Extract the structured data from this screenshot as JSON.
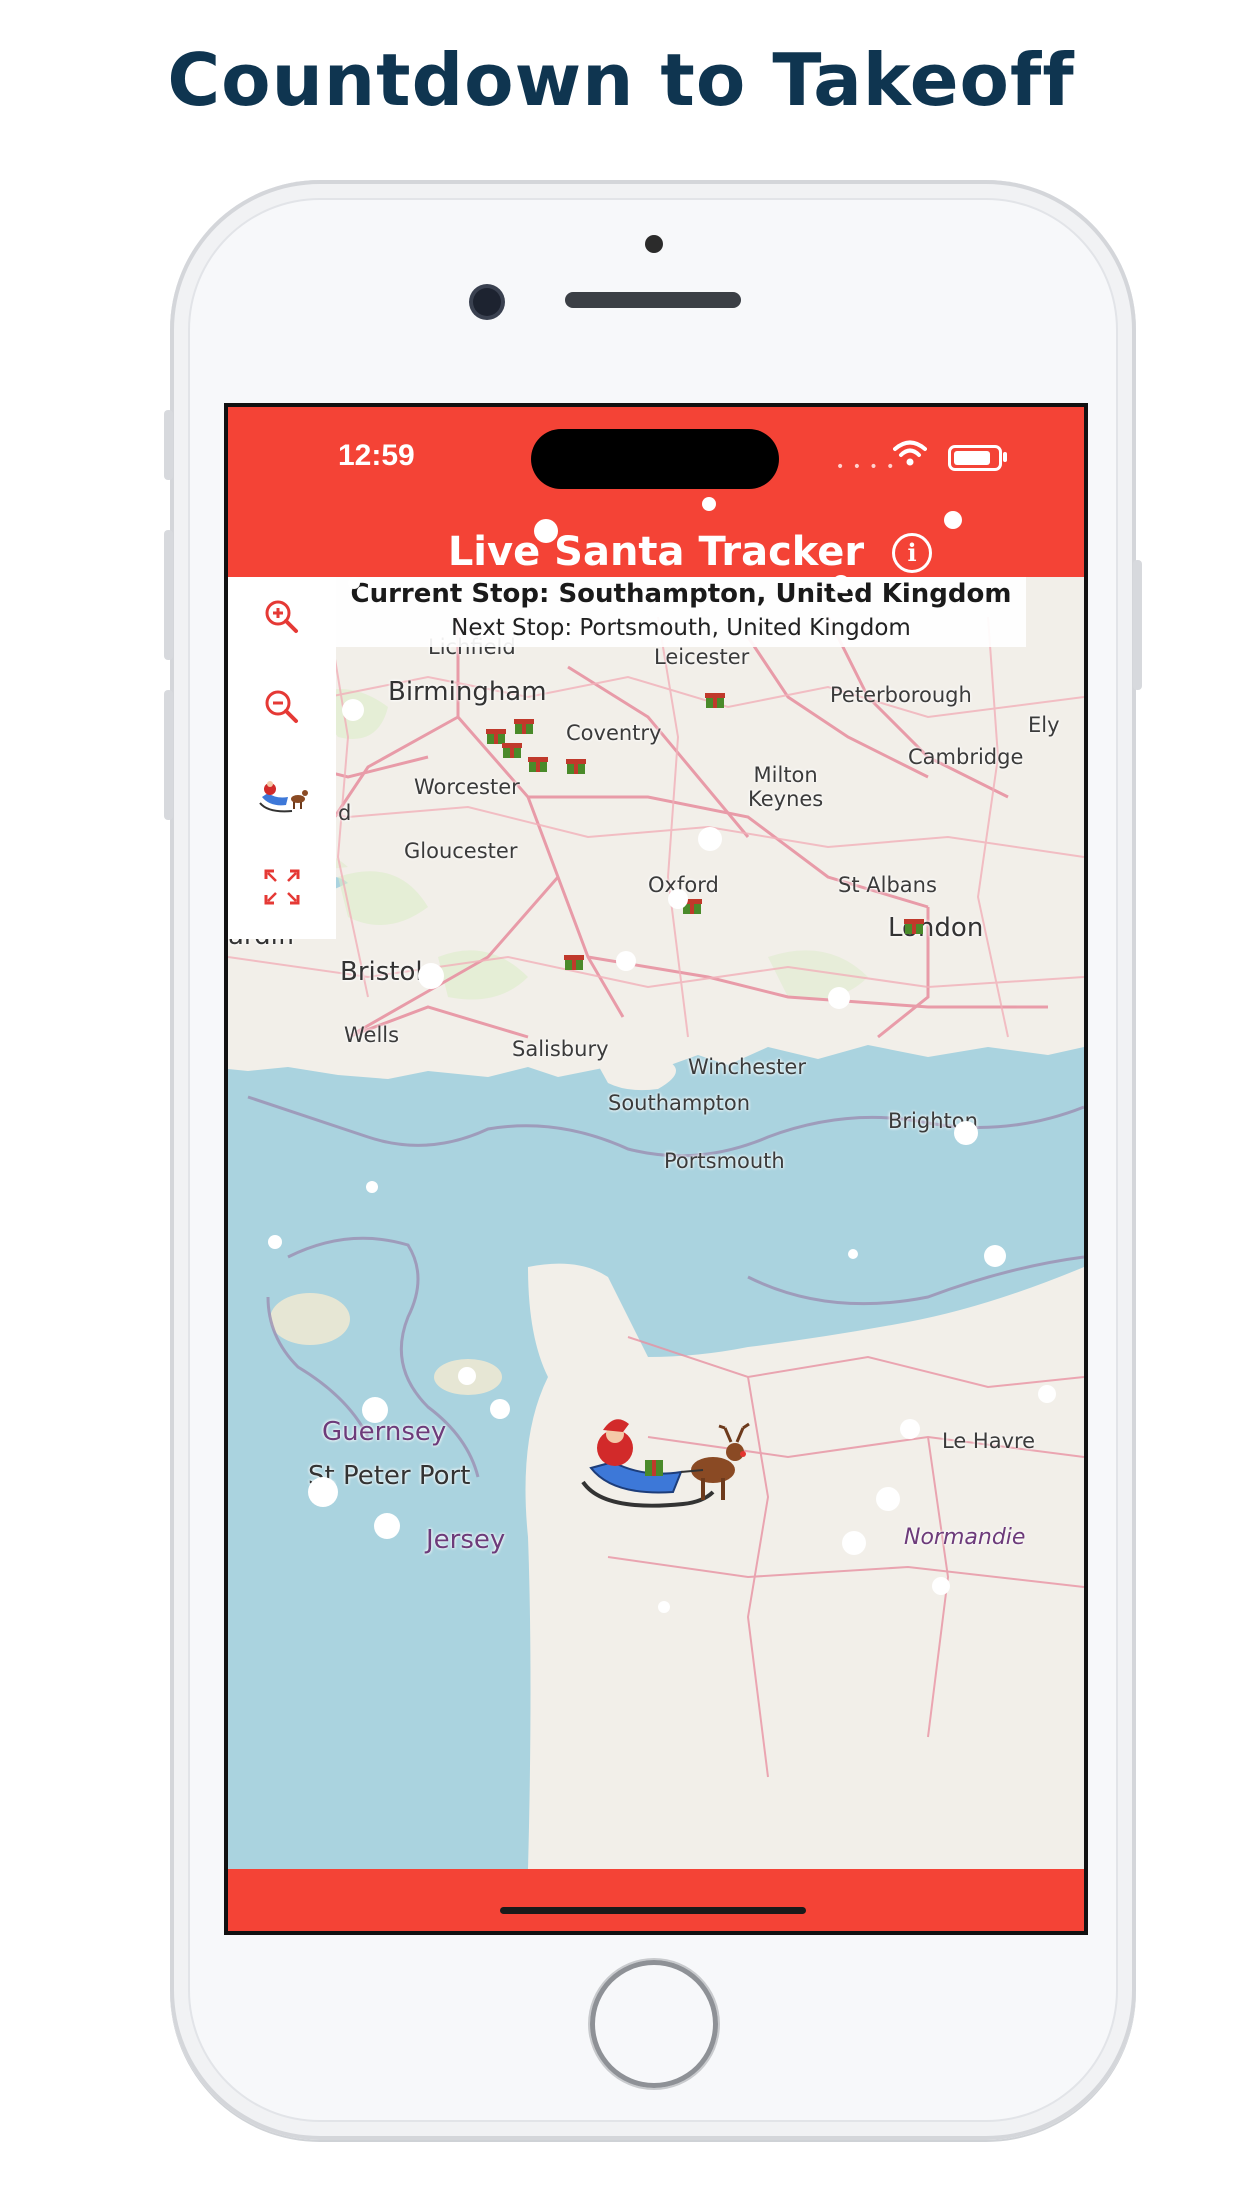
{
  "page": {
    "headline": "Countdown to Takeoff"
  },
  "status_bar": {
    "time": "12:59"
  },
  "app_bar": {
    "title": "Live Santa Tracker",
    "info_icon": "info-icon"
  },
  "stops": {
    "current": "Current Stop: Southampton, United Kingdom",
    "next": "Next Stop: Portsmouth, United Kingdom"
  },
  "map_controls": [
    {
      "name": "zoom-in-button",
      "icon": "zoom-in-icon"
    },
    {
      "name": "zoom-out-button",
      "icon": "zoom-out-icon"
    },
    {
      "name": "locate-santa-button",
      "icon": "sleigh-icon"
    },
    {
      "name": "fullscreen-button",
      "icon": "fullscreen-icon"
    }
  ],
  "map_labels": {
    "lichfield": "Lichfield",
    "leicester": "Leicester",
    "birmingham": "Birmingham",
    "peterborough": "Peterborough",
    "ely": "Ely",
    "coventry": "Coventry",
    "cambridge": "Cambridge",
    "worcester": "Worcester",
    "milton_keynes": "Milton\nKeynes",
    "gloucester": "Gloucester",
    "oxford": "Oxford",
    "st_albans": "St Albans",
    "cardiff": "ardiff",
    "london": "London",
    "bristol": "Bristol",
    "wells": "Wells",
    "salisbury": "Salisbury",
    "winchester": "Winchester",
    "southampton": "Southampton",
    "brighton": "Brighton",
    "portsmouth": "Portsmouth",
    "guernsey": "Guernsey",
    "st_peter_port": "St Peter Port",
    "jersey": "Jersey",
    "le_havre": "Le Havre",
    "normandie": "Normandie",
    "edge_d": "d"
  },
  "colors": {
    "brand_red": "#f44336",
    "headline": "#0f3550",
    "sea": "#aad3df",
    "land": "#f2efe9"
  }
}
